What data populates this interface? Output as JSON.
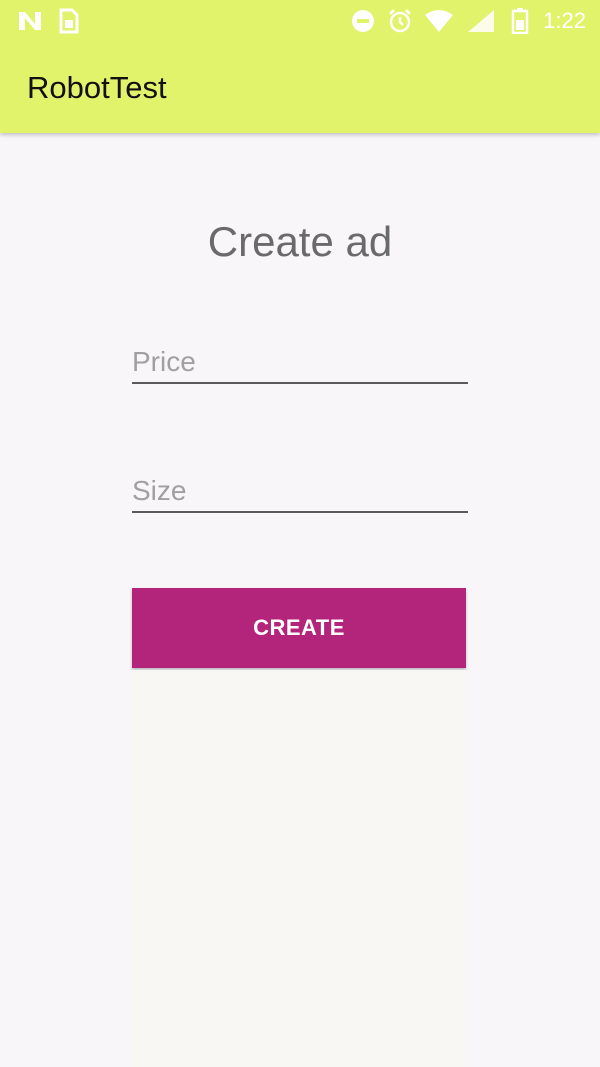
{
  "status_bar": {
    "time": "1:22",
    "icons": [
      "n-logo-icon",
      "sim-card-icon",
      "do-not-disturb-icon",
      "alarm-clock-icon",
      "wifi-icon",
      "signal-icon",
      "battery-icon"
    ]
  },
  "app_bar": {
    "title": "RobotTest",
    "background": "#e1f26b"
  },
  "form": {
    "heading": "Create ad",
    "price_placeholder": "Price",
    "price_value": "",
    "size_placeholder": "Size",
    "size_value": "",
    "create_label": "CREATE",
    "button_color": "#b3247b"
  }
}
